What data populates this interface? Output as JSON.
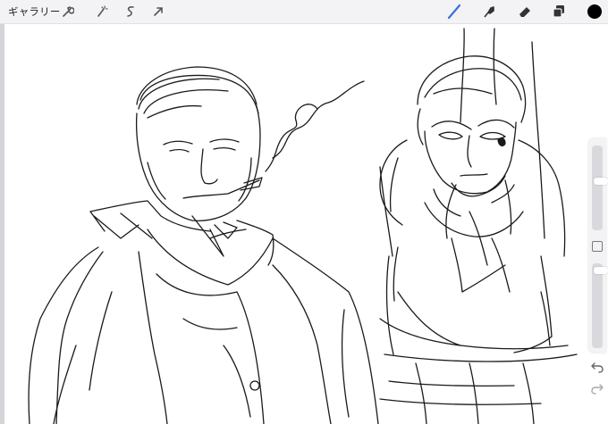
{
  "toolbar": {
    "gallery_label": "ギャラリー",
    "left_tools": [
      "wrench-icon",
      "magic-wand-icon",
      "selection-s-icon",
      "transform-arrow-icon"
    ],
    "right_tools": [
      "brush-icon",
      "smudge-icon",
      "eraser-icon",
      "layers-icon",
      "color-swatch"
    ],
    "active_tool": "brush",
    "colors": {
      "active_tool": "#3b6fe0",
      "current_color": "#000000"
    }
  },
  "sidebar": {
    "controls": [
      "brush-size-slider",
      "modify-button",
      "opacity-slider",
      "undo-icon",
      "redo-icon"
    ]
  },
  "canvas": {
    "content": "pencil-sketch"
  }
}
